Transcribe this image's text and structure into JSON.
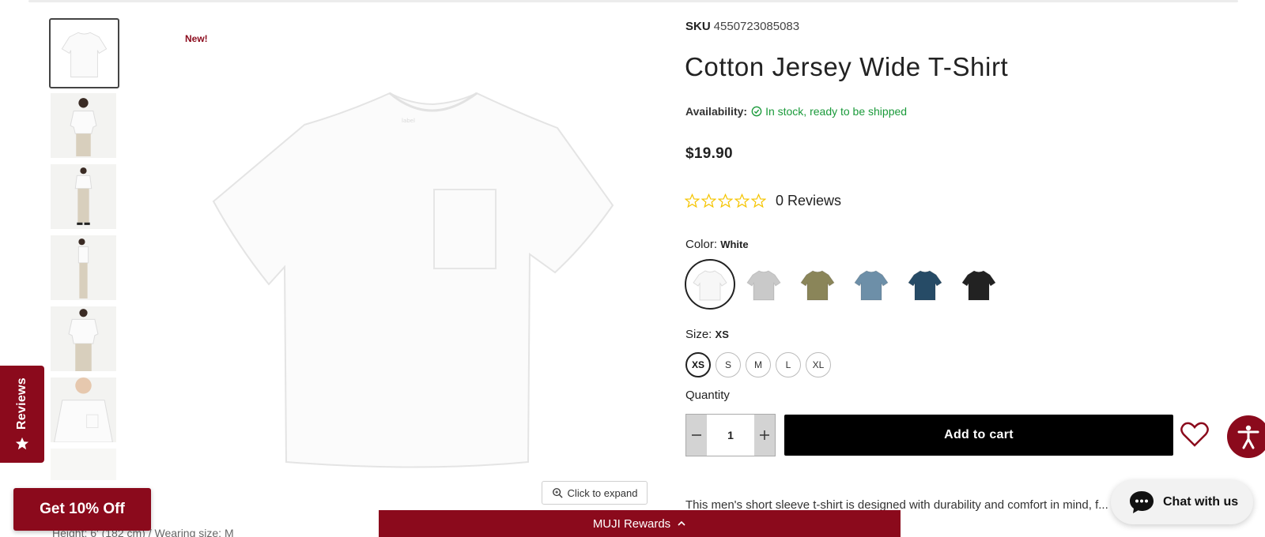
{
  "badge": "New!",
  "thumbnails": [
    {
      "label": "front flat"
    },
    {
      "label": "model front"
    },
    {
      "label": "model full"
    },
    {
      "label": "model side"
    },
    {
      "label": "model back"
    },
    {
      "label": "model close-up"
    },
    {
      "label": "detail"
    }
  ],
  "gallery": {
    "expand_label": "Click to expand",
    "height_note": "Height: 6' (182 cm) / Wearing size: M"
  },
  "product": {
    "sku_label": "SKU",
    "sku_value": "4550723085083",
    "title": "Cotton Jersey Wide T-Shirt",
    "availability_label": "Availability:",
    "availability_value": "In stock, ready to be shipped",
    "price": "$19.90",
    "rating": 0,
    "reviews_count": "0 Reviews",
    "color_label": "Color:",
    "color_selected": "White",
    "colors": [
      {
        "name": "White",
        "hex": "#f7f7f7"
      },
      {
        "name": "Gray",
        "hex": "#c9c9c9"
      },
      {
        "name": "Khaki",
        "hex": "#8a8559"
      },
      {
        "name": "Blue",
        "hex": "#6d8fa8"
      },
      {
        "name": "Navy",
        "hex": "#264b66"
      },
      {
        "name": "Black",
        "hex": "#222222"
      }
    ],
    "size_label": "Size:",
    "size_selected": "XS",
    "sizes": [
      "XS",
      "S",
      "M",
      "L",
      "XL"
    ],
    "quantity_label": "Quantity",
    "quantity": "1",
    "add_to_cart": "Add to cart",
    "description": "This men's short sleeve t-shirt is designed with durability and comfort in mind, f... e-washed organic cotton jersey for a soft touch. It has a"
  },
  "widgets": {
    "reviews_tab": "Reviews",
    "promo": "Get 10% Off",
    "rewards": "MUJI Rewards",
    "chat": "Chat with us"
  },
  "colors": {
    "brand": "#8b0a1c",
    "in_stock": "#1a9a3a",
    "star": "#f5c400"
  }
}
